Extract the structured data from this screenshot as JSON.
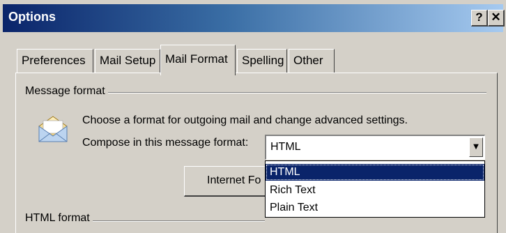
{
  "window": {
    "title": "Options"
  },
  "titlebar": {
    "help_label": "?",
    "close_label": "✕"
  },
  "tabs": [
    {
      "label": "Preferences"
    },
    {
      "label": "Mail Setup"
    },
    {
      "label": "Mail Format",
      "active": true
    },
    {
      "label": "Spelling"
    },
    {
      "label": "Other"
    }
  ],
  "message_format": {
    "group_label": "Message format",
    "description": "Choose a format for outgoing mail and change advanced settings.",
    "compose_label": "Compose in this message format:",
    "compose_value": "HTML",
    "options": [
      "HTML",
      "Rich Text",
      "Plain Text"
    ],
    "button_label": "Internet Fo"
  },
  "html_format": {
    "group_label": "HTML format"
  },
  "colors": {
    "title_start": "#0a246a",
    "title_end": "#a6caf0",
    "selection": "#0a246a",
    "face": "#d4d0c8"
  },
  "icons": {
    "message": "envelope-icon",
    "dropdown": "chevron-down-icon"
  }
}
